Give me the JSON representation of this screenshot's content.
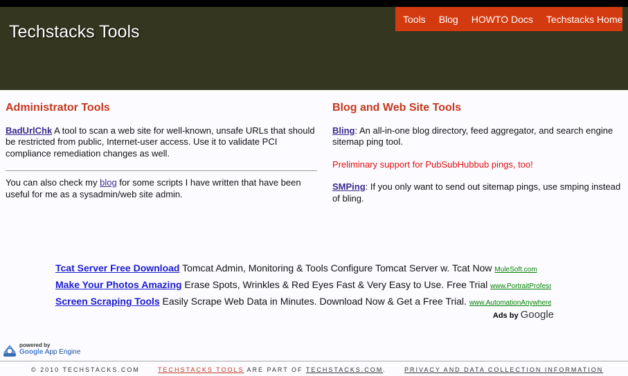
{
  "header": {
    "title": "Techstacks Tools",
    "nav": [
      "Tools",
      "Blog",
      "HOWTO Docs",
      "Techstacks Home"
    ]
  },
  "left": {
    "heading": "Administrator Tools",
    "tool_link": "BadUrlChk",
    "tool_desc": "  A tool to scan a web site for well-known, unsafe URLs that should be restricted from public, Internet-user access.  Use it to validate PCI compliance remediation changes as well.",
    "blog_pre": "You can also check my ",
    "blog_link": "blog",
    "blog_post": " for some scripts I have written that have been useful for me as a sysadmin/web site admin."
  },
  "right": {
    "heading": "Blog and Web Site Tools",
    "bling_link": "Bling",
    "bling_desc": ":  An all-in-one blog directory, feed aggregator, and search engine sitemap ping tool.",
    "notice": "Preliminary support for PubSubHubbub pings, too!",
    "smping_link": "SMPing",
    "smping_desc": ":  If you only want to send out sitemap pings, use smping instead of bling."
  },
  "ads": {
    "items": [
      {
        "title": "Tcat Server Free Download",
        "text": " Tomcat Admin, Monitoring & Tools Configure Tomcat Server w. Tcat Now ",
        "url": "MuleSoft.com"
      },
      {
        "title": "Make Your Photos Amazing",
        "text": " Erase Spots, Wrinkles & Red Eyes Fast & Very Easy to Use. Free Trial ",
        "url": "www.PortraitProfessional.com"
      },
      {
        "title": "Screen Scraping Tools",
        "text": " Easily Scrape Web Data in Minutes. Download Now & Get a Free Trial. ",
        "url": "www.AutomationAnywhere.com"
      }
    ],
    "ads_by": "Ads by ",
    "google": "Google"
  },
  "badge": {
    "small": "powered by",
    "google": "Google",
    "engine": "App Engine"
  },
  "footer": {
    "copyright": "© 2010 TECHSTACKS.COM",
    "tools_link": "TECHSTACKS TOOLS",
    "mid": " ARE PART OF ",
    "site_link": "TECHSTACKS.COM",
    "dot": ".",
    "privacy": "PRIVACY AND DATA COLLECTION INFORMATION"
  }
}
